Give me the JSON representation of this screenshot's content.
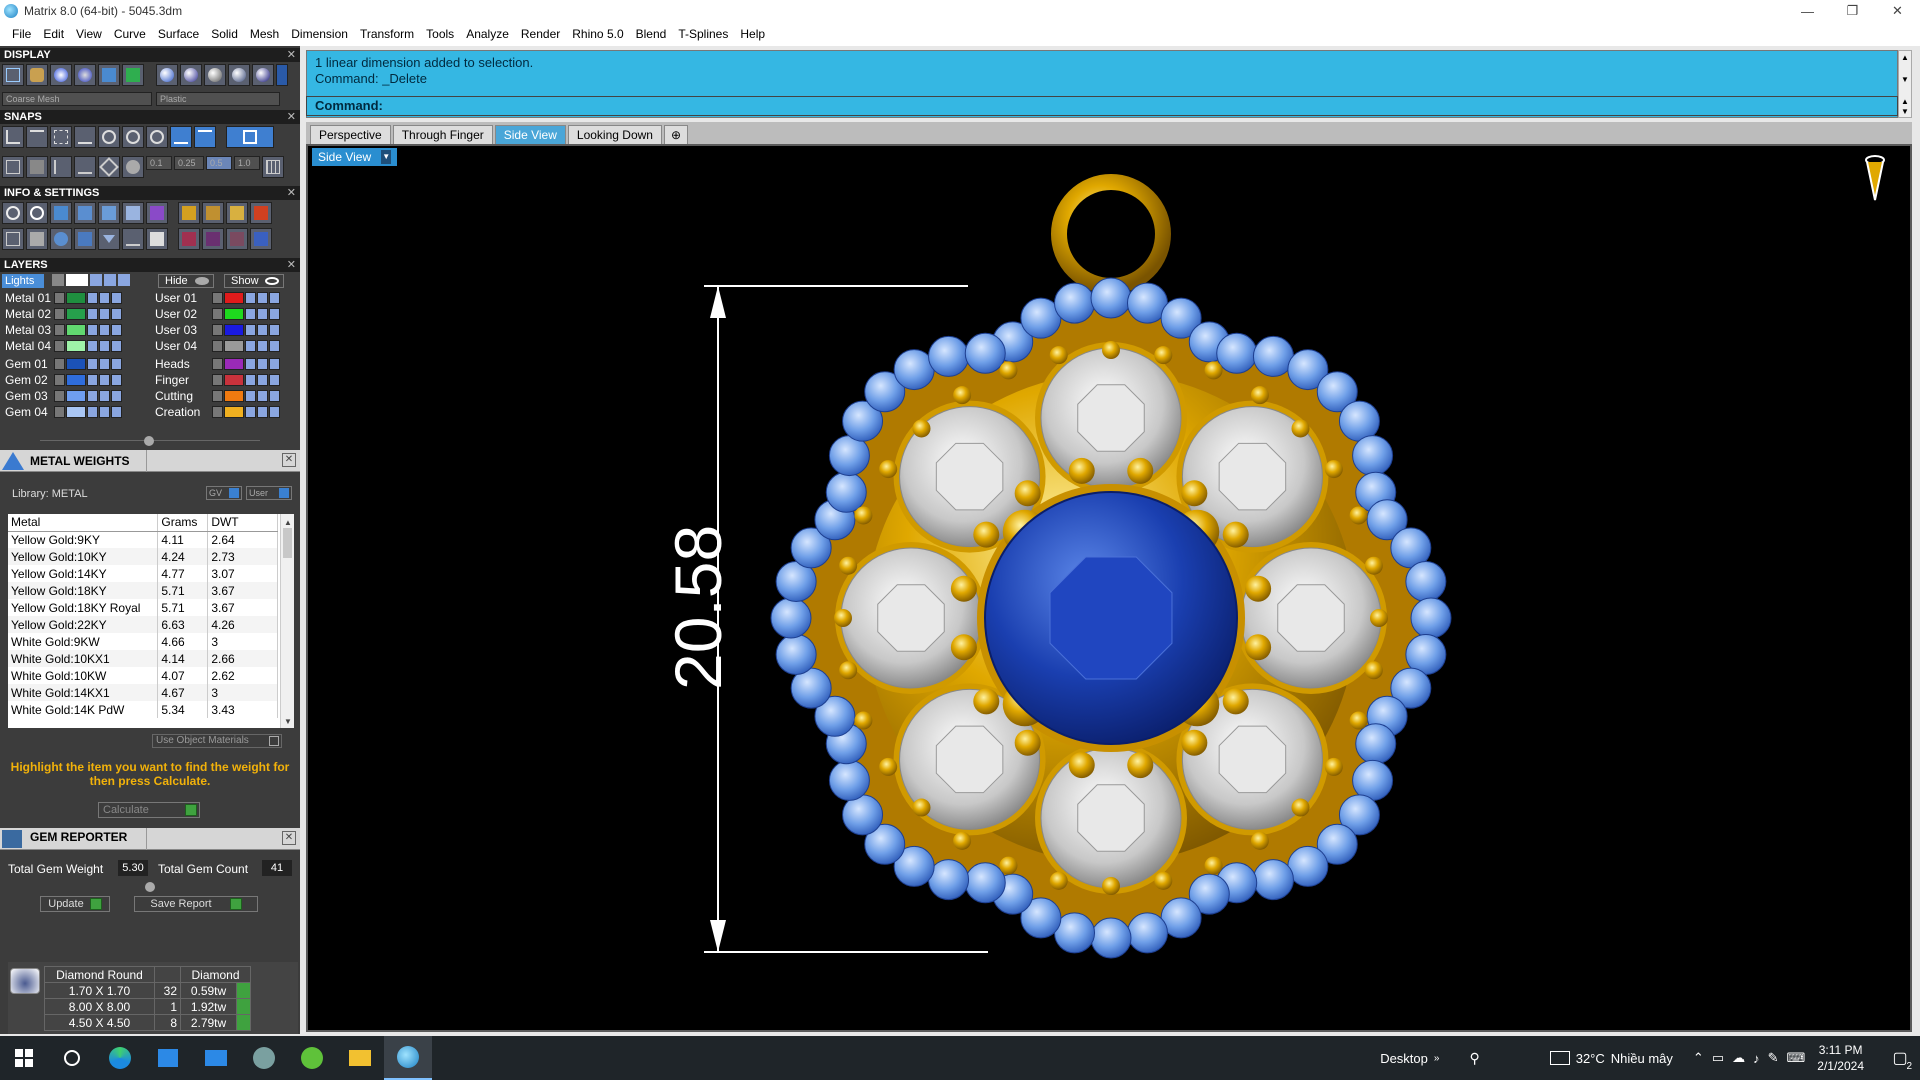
{
  "window": {
    "title": "Matrix 8.0 (64-bit) - 5045.3dm",
    "minimize": "—",
    "maximize": "❐",
    "close": "✕"
  },
  "menu": [
    "File",
    "Edit",
    "View",
    "Curve",
    "Surface",
    "Solid",
    "Mesh",
    "Dimension",
    "Transform",
    "Tools",
    "Analyze",
    "Render",
    "Rhino 5.0",
    "Blend",
    "T-Splines",
    "Help"
  ],
  "panels": {
    "display": {
      "title": "DISPLAY",
      "mesh_select": "Coarse Mesh",
      "material_select": "Plastic"
    },
    "snaps": {
      "title": "SNAPS",
      "steps": [
        "0.1",
        "0.25",
        "0.5",
        "1.0"
      ]
    },
    "info": {
      "title": "INFO & SETTINGS"
    },
    "layers": {
      "title": "LAYERS",
      "lights_label": "Lights",
      "hide_label": "Hide",
      "show_label": "Show",
      "left": [
        {
          "name": "Metal 01",
          "color": "#1f8f3f"
        },
        {
          "name": "Metal 02",
          "color": "#26a04c"
        },
        {
          "name": "Metal 03",
          "color": "#61d870"
        },
        {
          "name": "Metal 04",
          "color": "#9ef2a8"
        },
        {
          "name": "Gem 01",
          "color": "#1b52b8"
        },
        {
          "name": "Gem 02",
          "color": "#2f6ddc"
        },
        {
          "name": "Gem 03",
          "color": "#6f9ef0"
        },
        {
          "name": "Gem 04",
          "color": "#a9c6f4"
        }
      ],
      "right": [
        {
          "name": "User 01",
          "color": "#e01b1b"
        },
        {
          "name": "User 02",
          "color": "#1ed81e"
        },
        {
          "name": "User 03",
          "color": "#1a1ae0"
        },
        {
          "name": "User 04",
          "color": "#9a9a9a"
        },
        {
          "name": "Heads",
          "color": "#9a2ab8"
        },
        {
          "name": "Finger",
          "color": "#c8323c"
        },
        {
          "name": "Cutting",
          "color": "#f07a10"
        },
        {
          "name": "Creation",
          "color": "#f0b020"
        }
      ]
    },
    "metal_weights": {
      "title": "METAL WEIGHTS",
      "library": "Library: METAL",
      "gv_label": "GV",
      "user_label": "User",
      "columns": [
        "Metal",
        "Grams",
        "DWT"
      ],
      "rows": [
        [
          "Yellow Gold:9KY",
          "4.11",
          "2.64"
        ],
        [
          "Yellow Gold:10KY",
          "4.24",
          "2.73"
        ],
        [
          "Yellow Gold:14KY",
          "4.77",
          "3.07"
        ],
        [
          "Yellow Gold:18KY",
          "5.71",
          "3.67"
        ],
        [
          "Yellow Gold:18KY Royal",
          "5.71",
          "3.67"
        ],
        [
          "Yellow Gold:22KY",
          "6.63",
          "4.26"
        ],
        [
          "White Gold:9KW",
          "4.66",
          "3"
        ],
        [
          "White Gold:10KX1",
          "4.14",
          "2.66"
        ],
        [
          "White Gold:10KW",
          "4.07",
          "2.62"
        ],
        [
          "White Gold:14KX1",
          "4.67",
          "3"
        ],
        [
          "White Gold:14K PdW",
          "5.34",
          "3.43"
        ]
      ],
      "use_object_materials": "Use Object Materials",
      "hint": "Highlight the item you want to find the weight for then press Calculate.",
      "calculate": "Calculate"
    },
    "gem_reporter": {
      "title": "GEM REPORTER",
      "total_weight_label": "Total Gem Weight",
      "total_weight": "5.30",
      "total_count_label": "Total Gem Count",
      "total_count": "41",
      "update": "Update",
      "save_report": "Save Report",
      "header": [
        "Diamond Round",
        "",
        "Diamond"
      ],
      "rows": [
        [
          "1.70 X 1.70",
          "32",
          "0.59tw"
        ],
        [
          "8.00 X 8.00",
          "1",
          "1.92tw"
        ],
        [
          "4.50 X 4.50",
          "8",
          "2.79tw"
        ]
      ]
    }
  },
  "command": {
    "history": [
      "1 linear dimension added to selection.",
      "Command: _Delete"
    ],
    "prompt": "Command:"
  },
  "viewport_tabs": [
    "Perspective",
    "Through Finger",
    "Side View",
    "Looking Down"
  ],
  "active_tab": "Side View",
  "viewport": {
    "label": "Side View",
    "dimension": "20.58"
  },
  "colors": {
    "gold": "#e0a800",
    "sapphire": "#1a3fb0",
    "aquamarine": "#6f9fe8",
    "diamond": "#e6e6e6",
    "cmd_bg": "#35b7e3"
  },
  "taskbar": {
    "desktop": "Desktop",
    "weather": "32°C",
    "weather_desc": "Nhiều mây",
    "time": "3:11 PM",
    "date": "2/1/2024",
    "notifications": "2"
  }
}
